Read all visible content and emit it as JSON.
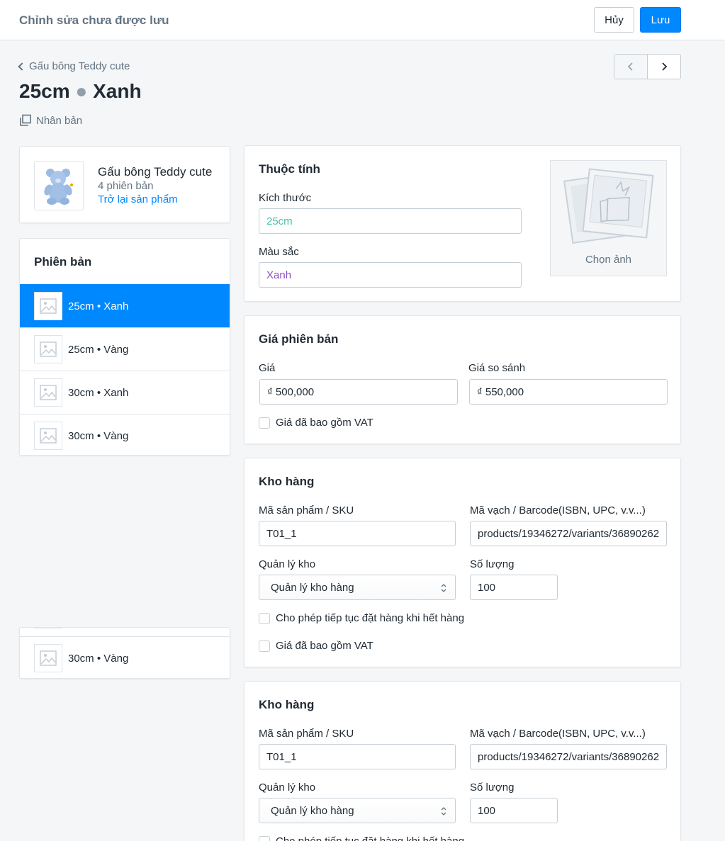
{
  "topbar": {
    "title": "Chỉnh sửa chưa được lưu",
    "cancel_label": "Hủy",
    "save_label": "Lưu"
  },
  "header": {
    "back_label": "Gấu bông Teddy cute",
    "title_size": "25cm",
    "title_dot": "●",
    "title_color": "Xanh",
    "duplicate_label": "Nhân bản"
  },
  "product": {
    "name": "Gấu bông Teddy cute",
    "variant_count": "4 phiên bản",
    "back_link": "Trở lại sản phẩm"
  },
  "variants": {
    "heading": "Phiên bản",
    "items": [
      {
        "label": "25cm • Xanh",
        "active": true
      },
      {
        "label": "25cm • Vàng"
      },
      {
        "label": "30cm • Xanh"
      },
      {
        "label": "30cm • Vàng"
      }
    ],
    "extra_item": "30cm • Vàng"
  },
  "attributes": {
    "title": "Thuộc tính",
    "size_label": "Kích thước",
    "size_value": "25cm",
    "size_color": "#47c1a8",
    "color_label": "Màu sắc",
    "color_value": "Xanh",
    "color_color": "#8a4fbf",
    "image_label": "Chọn ảnh"
  },
  "pricing": {
    "title": "Giá phiên bản",
    "price_label": "Giá",
    "price_value": "₫ 500,000",
    "compare_label": "Giá so sánh",
    "compare_value": "₫ 550,000",
    "vat_label": "Giá đã bao gồm VAT"
  },
  "inventory": [
    {
      "title": "Kho hàng",
      "sku_label": "Mã sản phẩm / SKU",
      "sku_value": "T01_1",
      "barcode_label": "Mã vạch / Barcode(ISBN, UPC, v.v...)",
      "barcode_value": "products/19346272/variants/36890262",
      "manage_label": "Quản lý kho",
      "manage_value": "Quản lý kho hàng",
      "qty_label": "Số lượng",
      "qty_value": "100",
      "backorder_label": "Cho phép tiếp tục đặt hàng khi hết hàng",
      "vat_label": "Giá đã bao gồm VAT"
    },
    {
      "title": "Kho hàng",
      "sku_label": "Mã sản phẩm / SKU",
      "sku_value": "T01_1",
      "barcode_label": "Mã vạch / Barcode(ISBN, UPC, v.v...)",
      "barcode_value": "products/19346272/variants/36890262",
      "manage_label": "Quản lý kho",
      "manage_value": "Quản lý kho hàng",
      "qty_label": "Số lượng",
      "qty_value": "100",
      "backorder_label": "Cho phép tiếp tục đặt hàng khi hết hàng"
    }
  ],
  "colors": {
    "primary": "#0088ff",
    "muted": "#637381",
    "background": "#f4f6f8"
  }
}
